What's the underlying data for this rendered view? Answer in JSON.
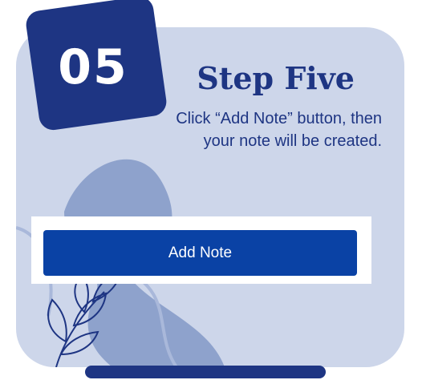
{
  "step": {
    "number": "05",
    "title": "Step Five",
    "description": "Click “Add Note” button, then your note will be created."
  },
  "button": {
    "label": "Add Note"
  },
  "colors": {
    "card_background": "#cdd6ea",
    "badge": "#1e3583",
    "title_text": "#1e3583",
    "button": "#0a42a5",
    "decor_shape": "#8ea2cc",
    "decor_line": "#1e3583"
  },
  "icons": {
    "decoration": "leaf-branch-icon"
  }
}
